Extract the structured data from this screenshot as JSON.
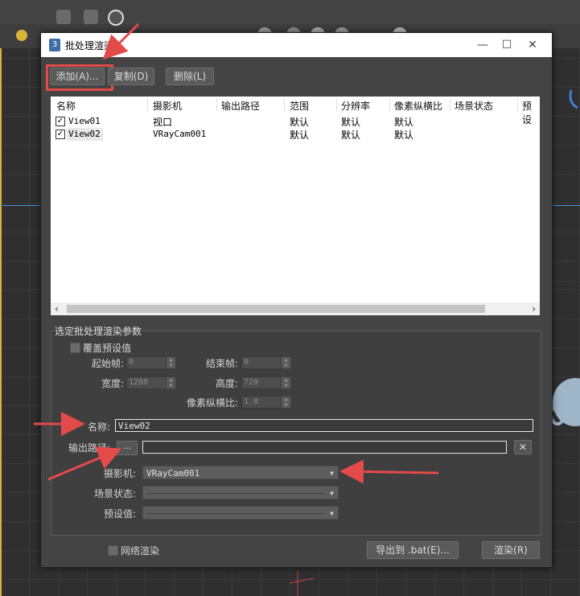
{
  "dialog": {
    "title": "批处理渲染",
    "buttons": {
      "add": "添加(A)...",
      "copy": "复制(D)",
      "delete": "删除(L)",
      "export": "导出到 .bat(E)...",
      "render": "渲染(R)"
    },
    "window_controls": {
      "minimize": "—",
      "maximize": "☐",
      "close": "✕"
    }
  },
  "list": {
    "columns": [
      "名称",
      "摄影机",
      "输出路径",
      "范围",
      "分辨率",
      "像素纵横比",
      "场景状态",
      "预设"
    ],
    "rows": [
      {
        "checked": true,
        "name": "View01",
        "camera": "视口",
        "output": "",
        "range": "默认",
        "resolution": "默认",
        "aspect": "默认"
      },
      {
        "checked": true,
        "name": "View02",
        "camera": "VRayCam001",
        "output": "",
        "range": "默认",
        "resolution": "默认",
        "aspect": "默认"
      }
    ]
  },
  "params": {
    "group_title": "选定批处理渲染参数",
    "override_label": "覆盖预设值",
    "start_frame_label": "起始帧:",
    "start_frame": "0",
    "end_frame_label": "结束帧:",
    "end_frame": "0",
    "width_label": "宽度:",
    "width": "1280",
    "height_label": "高度:",
    "height": "720",
    "aspect_label": "像素纵横比:",
    "aspect": "1.0",
    "name_label": "名称:",
    "name_value": "View02",
    "output_label": "输出路径:",
    "browse_label": "...",
    "output_value": "",
    "camera_label": "摄影机:",
    "camera_value": "VRayCam001",
    "scene_state_label": "场景状态:",
    "scene_state_value": "",
    "preset_label": "预设值:",
    "preset_value": ""
  },
  "footer": {
    "net_render_label": "网络渲染"
  },
  "colors": {
    "annotation": "#e34a4a",
    "dialog_bg": "#444444",
    "list_bg": "#ffffff"
  }
}
